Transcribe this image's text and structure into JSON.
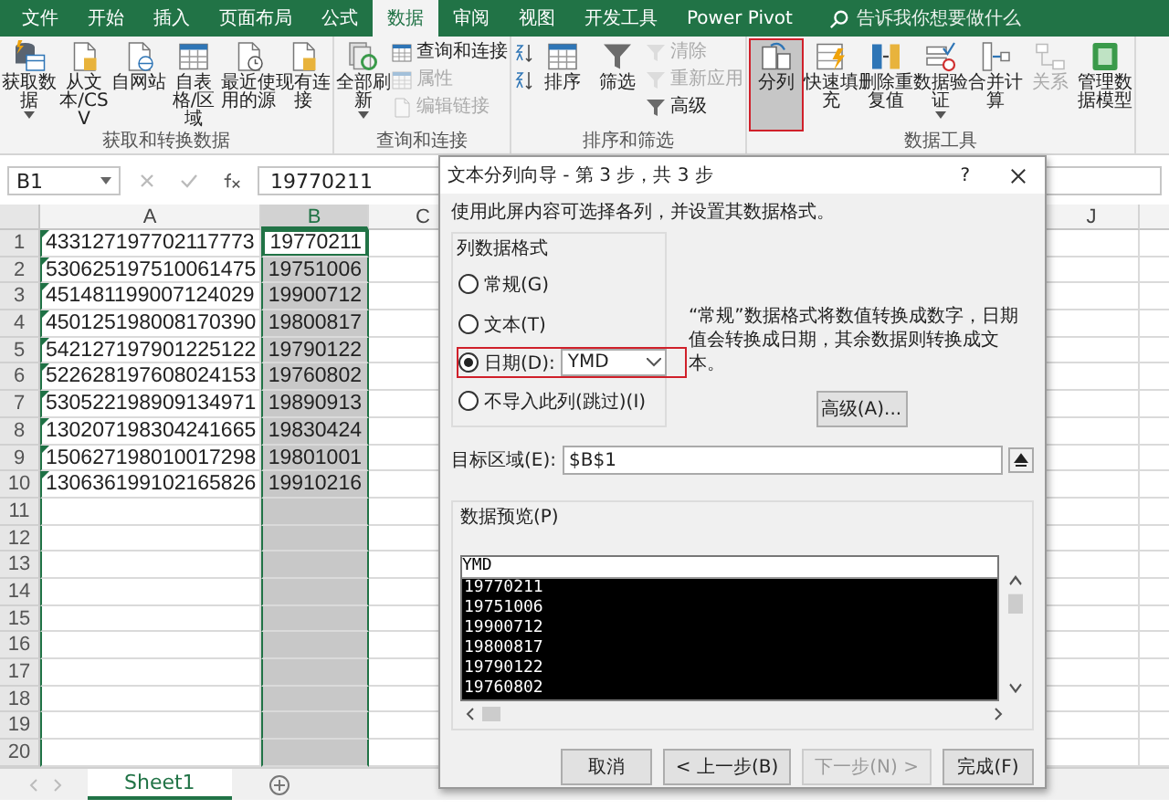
{
  "tabs": [
    {
      "label": "文件",
      "selected": false
    },
    {
      "label": "开始",
      "selected": false
    },
    {
      "label": "插入",
      "selected": false
    },
    {
      "label": "页面布局",
      "selected": false
    },
    {
      "label": "公式",
      "selected": false
    },
    {
      "label": "数据",
      "selected": true
    },
    {
      "label": "审阅",
      "selected": false
    },
    {
      "label": "视图",
      "selected": false
    },
    {
      "label": "开发工具",
      "selected": false
    },
    {
      "label": "Power Pivot",
      "selected": false
    }
  ],
  "search": {
    "placeholder": "告诉我你想要做什么"
  },
  "ribbon_groups": [
    {
      "label": "获取和转换数据",
      "columns": [
        {
          "kind": "large",
          "label": "获取数据",
          "dropdown": true,
          "highlighted": false
        },
        {
          "kind": "large",
          "label": "从文本/CSV",
          "dropdown": false,
          "highlighted": false
        },
        {
          "kind": "large",
          "label": "自网站",
          "dropdown": false,
          "highlighted": false
        },
        {
          "kind": "large",
          "label": "自表格/区域",
          "dropdown": false,
          "highlighted": false
        },
        {
          "kind": "large",
          "label": "最近使用的源",
          "dropdown": false,
          "highlighted": false
        },
        {
          "kind": "large",
          "label": "现有连接",
          "dropdown": false,
          "highlighted": false
        }
      ]
    },
    {
      "label": "查询和连接",
      "columns": [
        {
          "kind": "large",
          "label": "全部刷新",
          "dropdown": true,
          "highlighted": false
        },
        {
          "kind": "stack",
          "items": [
            {
              "label": "查询和连接",
              "disabled": false
            },
            {
              "label": "属性",
              "disabled": true
            },
            {
              "label": "编辑链接",
              "disabled": true
            }
          ]
        }
      ]
    },
    {
      "label": "排序和筛选",
      "columns": [
        {
          "kind": "stack",
          "items": [
            {
              "disabled": false
            },
            {
              "disabled": false
            }
          ]
        },
        {
          "kind": "large",
          "label": "排序",
          "dropdown": false,
          "highlighted": false
        },
        {
          "kind": "large",
          "label": "筛选",
          "dropdown": false,
          "highlighted": false
        },
        {
          "kind": "stack",
          "items": [
            {
              "label": "清除",
              "disabled": true
            },
            {
              "label": "重新应用",
              "disabled": true
            },
            {
              "label": "高级",
              "disabled": false
            }
          ]
        }
      ]
    },
    {
      "label": "数据工具",
      "columns": [
        {
          "kind": "large",
          "label": "分列",
          "dropdown": false,
          "highlighted": true
        },
        {
          "kind": "large",
          "label": "快速填充",
          "dropdown": false,
          "highlighted": false
        },
        {
          "kind": "large",
          "label": "删除重复值",
          "dropdown": false,
          "highlighted": false
        },
        {
          "kind": "large",
          "label": "数据验证",
          "dropdown": true,
          "highlighted": false
        },
        {
          "kind": "large",
          "label": "合并计算",
          "dropdown": false,
          "highlighted": false
        },
        {
          "kind": "large",
          "label": "关系",
          "dropdown": false,
          "highlighted": false,
          "disabled": true
        },
        {
          "kind": "large",
          "label": "管理数据模型",
          "dropdown": false,
          "highlighted": false
        }
      ]
    }
  ],
  "formula_bar": {
    "name_box": "B1",
    "formula": "19770211"
  },
  "sheet": {
    "columns": [
      {
        "label": "A",
        "selected": false
      },
      {
        "label": "B",
        "selected": true
      },
      {
        "label": "C",
        "selected": false
      },
      {
        "label": "J",
        "selected": false
      }
    ],
    "rows": [
      {
        "number": "1",
        "a": {
          "value": "433127197702117773",
          "flag": true
        },
        "b": {
          "value": "19770211",
          "active": true
        }
      },
      {
        "number": "2",
        "a": {
          "value": "530625197510061475",
          "flag": true
        },
        "b": {
          "value": "19751006",
          "active": false
        }
      },
      {
        "number": "3",
        "a": {
          "value": "451481199007124029",
          "flag": true
        },
        "b": {
          "value": "19900712",
          "active": false
        }
      },
      {
        "number": "4",
        "a": {
          "value": "450125198008170390",
          "flag": true
        },
        "b": {
          "value": "19800817",
          "active": false
        }
      },
      {
        "number": "5",
        "a": {
          "value": "542127197901225122",
          "flag": true
        },
        "b": {
          "value": "19790122",
          "active": false
        }
      },
      {
        "number": "6",
        "a": {
          "value": "522628197608024153",
          "flag": true
        },
        "b": {
          "value": "19760802",
          "active": false
        }
      },
      {
        "number": "7",
        "a": {
          "value": "530522198909134971",
          "flag": true
        },
        "b": {
          "value": "19890913",
          "active": false
        }
      },
      {
        "number": "8",
        "a": {
          "value": "130207198304241665",
          "flag": true
        },
        "b": {
          "value": "19830424",
          "active": false
        }
      },
      {
        "number": "9",
        "a": {
          "value": "150627198010017298",
          "flag": true
        },
        "b": {
          "value": "19801001",
          "active": false
        }
      },
      {
        "number": "10",
        "a": {
          "value": "130636199102165826",
          "flag": true
        },
        "b": {
          "value": "19910216",
          "active": false
        }
      },
      {
        "number": "11",
        "a": {
          "flag": false
        },
        "b": {
          "active": false
        }
      },
      {
        "number": "12",
        "a": {
          "flag": false
        },
        "b": {
          "active": false
        }
      },
      {
        "number": "13",
        "a": {
          "flag": false
        },
        "b": {
          "active": false
        }
      },
      {
        "number": "14",
        "a": {
          "flag": false
        },
        "b": {
          "active": false
        }
      },
      {
        "number": "15",
        "a": {
          "flag": false
        },
        "b": {
          "active": false
        }
      },
      {
        "number": "16",
        "a": {
          "flag": false
        },
        "b": {
          "active": false
        }
      },
      {
        "number": "17",
        "a": {
          "flag": false
        },
        "b": {
          "active": false
        }
      },
      {
        "number": "18",
        "a": {
          "flag": false
        },
        "b": {
          "active": false
        }
      },
      {
        "number": "19",
        "a": {
          "flag": false
        },
        "b": {
          "active": false
        }
      },
      {
        "number": "20",
        "a": {
          "flag": false
        },
        "b": {
          "active": false
        }
      }
    ],
    "sheet_tabs": [
      {
        "label": "Sheet1",
        "selected": true
      }
    ]
  },
  "dialog": {
    "title": "文本分列向导 - 第 3 步，共 3 步",
    "help": "?",
    "instruction": "使用此屏内容可选择各列，并设置其数据格式。",
    "format_group": {
      "label": "列数据格式",
      "options": [
        {
          "label": "常规(G)",
          "selected": false,
          "highlighted": false
        },
        {
          "label": "文本(T)",
          "selected": false,
          "highlighted": false
        },
        {
          "label": "日期(D):",
          "selected": true,
          "highlighted": true,
          "select_value": "YMD"
        },
        {
          "label": "不导入此列(跳过)(I)",
          "selected": false,
          "highlighted": false
        }
      ]
    },
    "description": "“常规”数据格式将数值转换成数字，日期值会转换成日期，其余数据则转换成文本。",
    "advanced_button": "高级(A)...",
    "destination": {
      "label": "目标区域(E):",
      "value": "$B$1"
    },
    "preview": {
      "label": "数据预览(P)",
      "header": "YMD",
      "rows": [
        "19770211",
        "19751006",
        "19900712",
        "19800817",
        "19790122",
        "19760802"
      ]
    },
    "buttons": [
      {
        "label": "取消",
        "disabled": false
      },
      {
        "label": "< 上一步(B)",
        "disabled": false
      },
      {
        "label": "下一步(N) >",
        "disabled": true
      },
      {
        "label": "完成(F)",
        "disabled": false
      }
    ]
  }
}
